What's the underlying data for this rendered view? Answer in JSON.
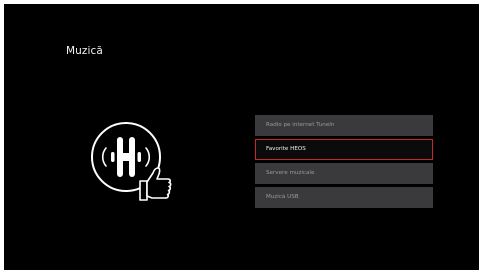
{
  "screen": {
    "title": "Muzică",
    "logo_icon": "heos-thumbs-up-icon"
  },
  "menu": {
    "items": [
      {
        "label": "Radio pe internet TuneIn",
        "selected": false
      },
      {
        "label": "Favorite HEOS",
        "selected": true
      },
      {
        "label": "Servere muzicale",
        "selected": false
      },
      {
        "label": "Muzică USB",
        "selected": false
      }
    ]
  },
  "colors": {
    "background": "#000000",
    "item_background": "#3a3a3c",
    "selection_border": "#c62828",
    "text": "#f2f2f2"
  }
}
